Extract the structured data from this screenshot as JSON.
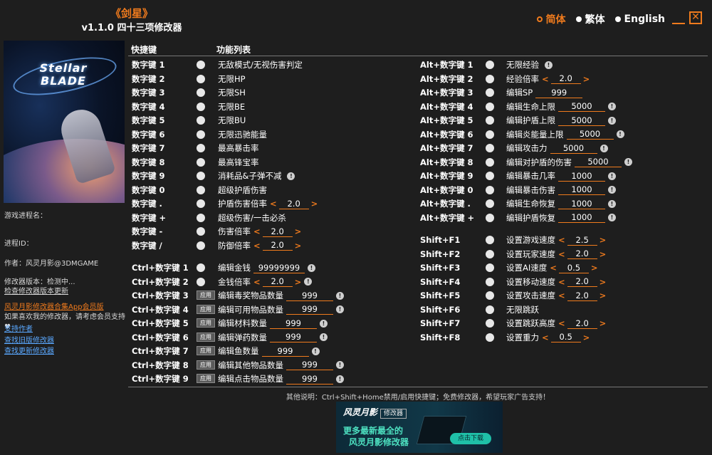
{
  "header": {
    "title": "《剑星》",
    "subtitle": "v1.1.0 四十三项修改器"
  },
  "languages": [
    {
      "label": "简体",
      "active": true
    },
    {
      "label": "繁体",
      "active": false
    },
    {
      "label": "English",
      "active": false
    }
  ],
  "window": {
    "minimize": "_",
    "close": "✕"
  },
  "cover": {
    "logo_line1": "Stellar",
    "logo_line2": "BLADE"
  },
  "left_panel": {
    "process_label": "游戏进程名：",
    "pid_label": "进程ID：",
    "author": "作者：风灵月影@3DMGAME",
    "version_status": "修改器版本：检测中...",
    "check_update": "检查修改器版本更新",
    "vip_link": "风灵月影修改器合集App会员版",
    "vip_desc": "如果喜欢我的修改器，请考虑会员支持",
    "support_author": "支持作者",
    "old_version": "查找旧版修改器",
    "new_version": "查找更新修改器"
  },
  "columns": {
    "hotkey": "快捷键",
    "functions": "功能列表"
  },
  "accent": "#f07b1d",
  "col1_numpad": [
    {
      "key": "数字键 1",
      "name": "无敌模式/无视伤害判定"
    },
    {
      "key": "数字键 2",
      "name": "无限HP"
    },
    {
      "key": "数字键 3",
      "name": "无限SH"
    },
    {
      "key": "数字键 4",
      "name": "无限BE"
    },
    {
      "key": "数字键 5",
      "name": "无限BU"
    },
    {
      "key": "数字键 6",
      "name": "无限迅驰能量"
    },
    {
      "key": "数字键 7",
      "name": "最高暴击率"
    },
    {
      "key": "数字键 8",
      "name": "最高锋宝率"
    },
    {
      "key": "数字键 9",
      "name": "消耗品&子弹不减",
      "info": "!"
    },
    {
      "key": "数字键 0",
      "name": "超级护盾伤害"
    },
    {
      "key": "数字键 .",
      "name": "护盾伤害倍率",
      "value": "2.0"
    },
    {
      "key": "数字键 +",
      "name": "超级伤害/一击必杀"
    },
    {
      "key": "数字键 -",
      "name": "伤害倍率",
      "value": "2.0"
    },
    {
      "key": "数字键 /",
      "name": "防御倍率",
      "value": "2.0"
    }
  ],
  "col1_ctrl": [
    {
      "key": "Ctrl+数字键 1",
      "name": "编辑金钱",
      "input": "99999999",
      "info": "!"
    },
    {
      "key": "Ctrl+数字键 2",
      "name": "金钱倍率",
      "value": "2.0",
      "info": "!"
    },
    {
      "key": "Ctrl+数字键 3",
      "apply": "应用",
      "name": "编辑毒奖物品数量",
      "input": "999",
      "info": "!"
    },
    {
      "key": "Ctrl+数字键 4",
      "apply": "应用",
      "name": "编辑可用物品数量",
      "input": "999",
      "info": "!"
    },
    {
      "key": "Ctrl+数字键 5",
      "apply": "应用",
      "name": "编辑材料数量",
      "input": "999",
      "info": "!"
    },
    {
      "key": "Ctrl+数字键 6",
      "apply": "应用",
      "name": "编辑弹药数量",
      "input": "999",
      "info": "!"
    },
    {
      "key": "Ctrl+数字键 7",
      "apply": "应用",
      "name": "编辑鱼数量",
      "input": "999",
      "info": "!"
    },
    {
      "key": "Ctrl+数字键 8",
      "apply": "应用",
      "name": "编辑其他物品数量",
      "input": "999",
      "info": "!"
    },
    {
      "key": "Ctrl+数字键 9",
      "apply": "应用",
      "name": "编辑点击物品数量",
      "input": "999",
      "info": "!"
    }
  ],
  "col2_alt": [
    {
      "key": "Alt+数字键 1",
      "name": "无限经验",
      "info": "!"
    },
    {
      "key": "Alt+数字键 2",
      "name": "经验倍率",
      "value": "2.0"
    },
    {
      "key": "Alt+数字键 3",
      "name": "编辑SP",
      "input": "999"
    },
    {
      "key": "Alt+数字键 4",
      "name": "编辑生命上限",
      "input": "5000",
      "info": "!"
    },
    {
      "key": "Alt+数字键 5",
      "name": "编辑护盾上限",
      "input": "5000",
      "info": "!"
    },
    {
      "key": "Alt+数字键 6",
      "name": "编辑炎能量上限",
      "input": "5000",
      "info": "!"
    },
    {
      "key": "Alt+数字键 7",
      "name": "编辑攻击力",
      "input": "5000",
      "info": "!"
    },
    {
      "key": "Alt+数字键 8",
      "name": "编辑对护盾的伤害",
      "input": "5000",
      "info": "!"
    },
    {
      "key": "Alt+数字键 9",
      "name": "编辑暴击几率",
      "input": "1000",
      "info": "!"
    },
    {
      "key": "Alt+数字键 0",
      "name": "编辑暴击伤害",
      "input": "1000",
      "info": "!"
    },
    {
      "key": "Alt+数字键 .",
      "name": "编辑生命恢复",
      "input": "1000",
      "info": "!"
    },
    {
      "key": "Alt+数字键 +",
      "name": "编辑护盾恢复",
      "input": "1000",
      "info": "!"
    }
  ],
  "col2_shift": [
    {
      "key": "Shift+F1",
      "name": "设置游戏速度",
      "value": "2.5"
    },
    {
      "key": "Shift+F2",
      "name": "设置玩家速度",
      "value": "2.0"
    },
    {
      "key": "Shift+F3",
      "name": "设置AI速度",
      "value": "0.5"
    },
    {
      "key": "Shift+F4",
      "name": "设置移动速度",
      "value": "2.0"
    },
    {
      "key": "Shift+F5",
      "name": "设置攻击速度",
      "value": "2.0"
    },
    {
      "key": "Shift+F6",
      "name": "无限跳跃"
    },
    {
      "key": "Shift+F7",
      "name": "设置跳跃高度",
      "value": "2.0"
    },
    {
      "key": "Shift+F8",
      "name": "设置重力",
      "value": "0.5"
    }
  ],
  "footer": {
    "note": "其他说明：Ctrl+Shift+Home禁用/启用快捷键；免费修改器，希望玩家广告支持！"
  },
  "ad": {
    "brand": "风灵月影",
    "tag": "修改器",
    "line1": "更多最新最全的",
    "line2": "风灵月影修改器",
    "download": "点击下载"
  }
}
